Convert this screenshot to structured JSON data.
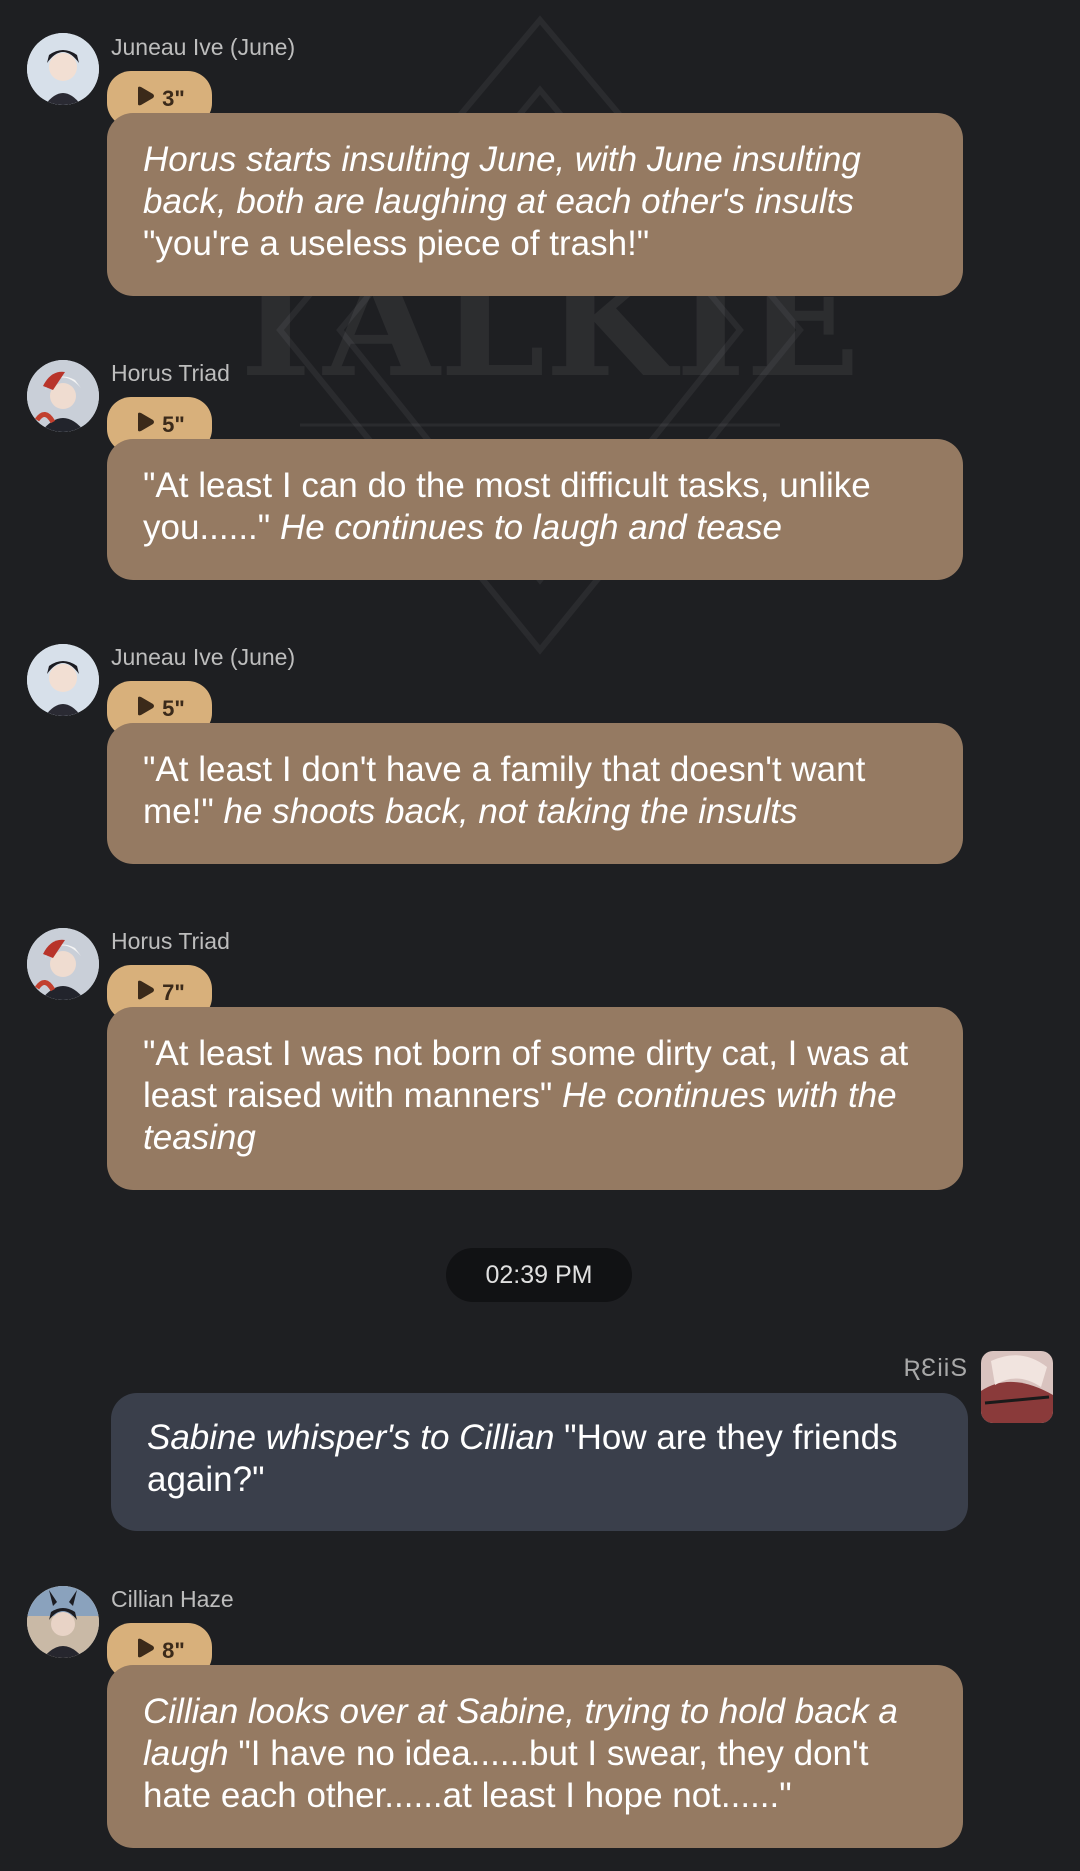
{
  "watermark": {
    "text": "TALKIE"
  },
  "messages": [
    {
      "sender": "Juneau Ive (June)",
      "duration": "3\"",
      "parts": [
        {
          "italic": true,
          "text": "Horus starts insulting June, with June insulting back, both are laughing at each other's insults"
        },
        {
          "italic": false,
          "text": " \"you're a useless piece of trash!\""
        }
      ]
    },
    {
      "sender": "Horus Triad",
      "duration": "5\"",
      "parts": [
        {
          "italic": false,
          "text": "\"At least I can do the most difficult tasks, unlike you......\" "
        },
        {
          "italic": true,
          "text": "He continues to laugh and tease"
        }
      ]
    },
    {
      "sender": "Juneau Ive (June)",
      "duration": "5\"",
      "parts": [
        {
          "italic": false,
          "text": "\"At least I don't have a family that doesn't want me!\" "
        },
        {
          "italic": true,
          "text": "he shoots back, not taking the insults"
        }
      ]
    },
    {
      "sender": "Horus Triad",
      "duration": "7\"",
      "parts": [
        {
          "italic": false,
          "text": "\"At least I was not born of some dirty cat, I was at least raised with manners\" "
        },
        {
          "italic": true,
          "text": "He continues with the teasing"
        }
      ]
    }
  ],
  "timestamp": "02:39 PM",
  "user": {
    "name": "ƦƐiiS",
    "parts": [
      {
        "italic": true,
        "text": "Sabine whisper's to Cillian"
      },
      {
        "italic": false,
        "text": " \"How are they friends again?\""
      }
    ]
  },
  "last_message": {
    "sender": "Cillian Haze",
    "duration": "8\"",
    "parts": [
      {
        "italic": true,
        "text": "Cillian looks over at Sabine, trying to hold back a laugh"
      },
      {
        "italic": false,
        "text": " \"I have no idea......but I swear, they don't hate each other......at least I hope not......\""
      }
    ]
  },
  "colors": {
    "background": "#1e1f22",
    "character_bubble": "#957a62",
    "user_bubble": "#3a3f4b",
    "voice_pill": "#d8b07b"
  }
}
